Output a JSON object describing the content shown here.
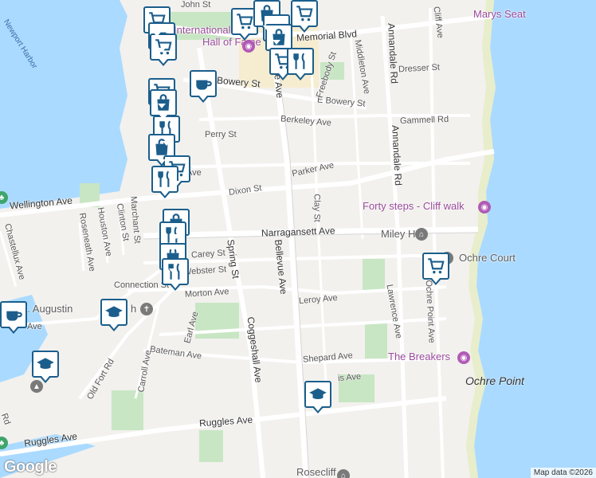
{
  "map": {
    "colors": {
      "water": "#aadaff",
      "land": "#f2f1ee",
      "park": "#c8e6c3",
      "road": "#ffffff",
      "pin_border": "#1b5e8c",
      "pin_icon": "#1b5e8c"
    },
    "streets": {
      "john": "John St",
      "memorial": "Memorial Blvd",
      "bowery": "Bowery St",
      "e_bowery": "E Bowery St",
      "dresser": "Dresser St",
      "gammell": "Gammell Rd",
      "berkeley": "Berkeley Ave",
      "perry": "Perry St",
      "parker": "Parker Ave",
      "dixon": "Dixon St",
      "wellington": "Wellington Ave",
      "narragansett": "Narragansett Ave",
      "clay": "Clay St",
      "freebody": "Freebody St",
      "middleton": "Middleton Ave",
      "annandale": "Annandale Rd",
      "annandale2": "Annandale Rd",
      "cliff": "Cliff Ave",
      "bellevue": "Bellevue Ave",
      "bellevue_top": "vue Ave",
      "spring": "Spring St",
      "coggeshall": "Coggeshall Ave",
      "leroy": "Leroy Ave",
      "lawrence": "Lawrence Ave",
      "ochre_point": "Ochre Point Ave",
      "shepard": "Shepard Ave",
      "bateman": "Bateman Ave",
      "morton": "Morton Ave",
      "connection": "Connection St",
      "webster": "Webster St",
      "carey": "Carey St",
      "earl": "Earl Ave",
      "carroll": "Carroll Ave",
      "old_fort": "Old Fort Rd",
      "ruggles": "Ruggles Ave",
      "houston": "Houston Ave",
      "roseneath": "Roseneath Ave",
      "clinton": "Clinton St",
      "marchant": "Marchant St",
      "chastellux": "Chastellux Ave",
      "edge_ave": "Ave",
      "edge_ave2": "Ave",
      "edge_rd": "Rd",
      "ridge_ave": "is Ave"
    },
    "pois": {
      "hall_of_fame_1": "International",
      "hall_of_fame_2": "Hall of Fame",
      "marys_seat": "Marys Seat",
      "forty_steps": "Forty steps - Cliff walk",
      "miley_hall": "Miley Hall",
      "ochre_court": "Ochre Court",
      "the_breakers": "The Breakers",
      "st_augustin": "St. Augustin",
      "st_augustin_tail": "h",
      "rosecliff": "Rosecliff"
    },
    "places": {
      "ochre_point": "Ochre Point"
    },
    "water": {
      "newport_harbor": "Newport Harbor"
    },
    "attribution": "Map data ©2026",
    "logo": "Google"
  }
}
